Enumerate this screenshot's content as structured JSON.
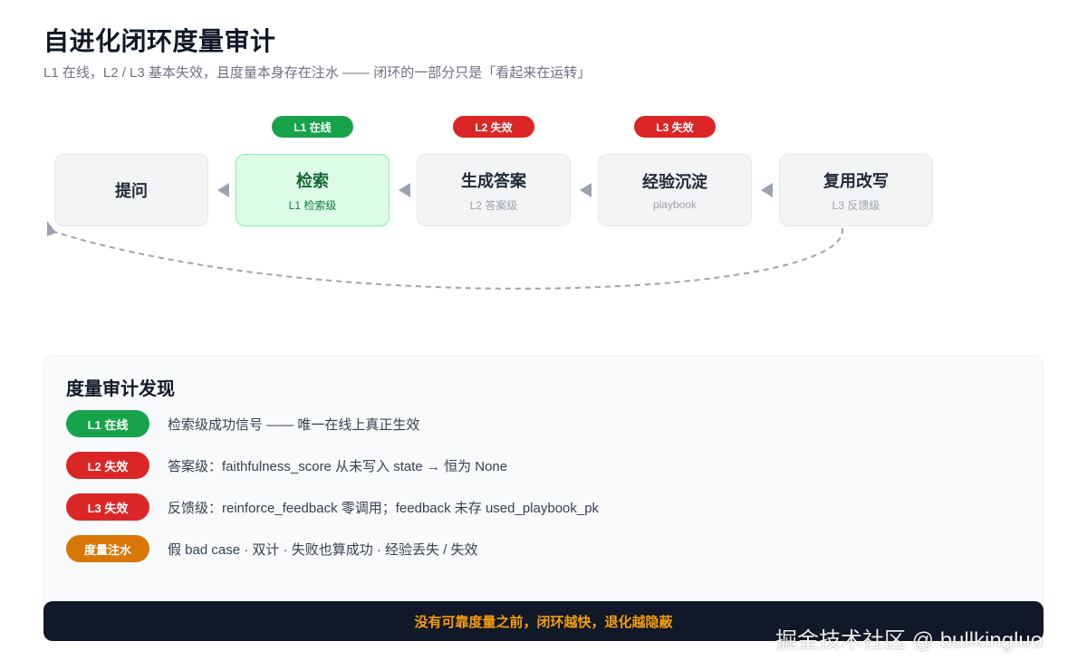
{
  "header": {
    "title": "自进化闭环度量审计",
    "subtitle": "L1 在线，L2 / L3 基本失效，且度量本身存在注水 —— 闭环的一部分只是「看起来在运转」"
  },
  "flow": {
    "badges": [
      {
        "label": "L1 在线",
        "color": "#16a34a"
      },
      {
        "label": "L2 失效",
        "color": "#dc2626"
      },
      {
        "label": "L3 失效",
        "color": "#dc2626"
      }
    ],
    "nodes": [
      {
        "title": "提问",
        "sub": ""
      },
      {
        "title": "检索",
        "sub": "L1 检索级"
      },
      {
        "title": "生成答案",
        "sub": "L2 答案级"
      },
      {
        "title": "经验沉淀",
        "sub": "playbook"
      },
      {
        "title": "复用改写",
        "sub": "L3 反馈级"
      }
    ]
  },
  "audit": {
    "title": "度量审计发现",
    "findings": [
      {
        "badge": "L1 在线",
        "color": "#16a34a",
        "text": "检索级成功信号 —— 唯一在线上真正生效"
      },
      {
        "badge": "L2 失效",
        "color": "#dc2626",
        "text": "答案级：faithfulness_score 从未写入 state → 恒为 None"
      },
      {
        "badge": "L3 失效",
        "color": "#dc2626",
        "text": "反馈级：reinforce_feedback 零调用；feedback 未存 used_playbook_pk"
      },
      {
        "badge": "度量注水",
        "color": "#d97706",
        "text": "假 bad case · 双计 · 失败也算成功 · 经验丢失 / 失效"
      }
    ]
  },
  "footer": {
    "text": "没有可靠度量之前，闭环越快，退化越隐蔽"
  },
  "watermark": "掘金技术社区 @ bullkingluo"
}
